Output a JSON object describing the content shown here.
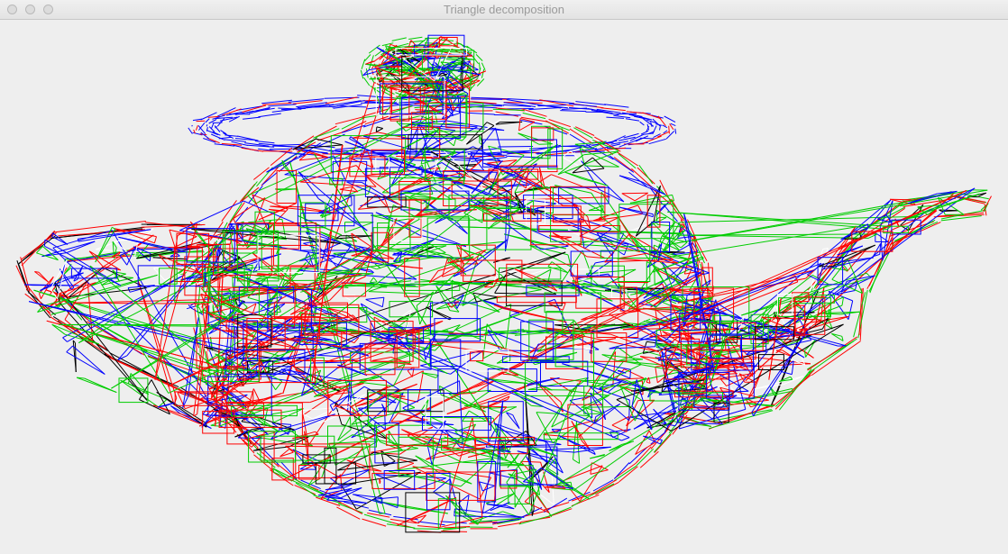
{
  "window": {
    "title": "Triangle decomposition"
  },
  "titlebar_buttons": [
    {
      "name": "close-button"
    },
    {
      "name": "minimize-button"
    },
    {
      "name": "zoom-button"
    }
  ],
  "canvas": {
    "background": "#eeeeee",
    "palette": [
      "#ff0000",
      "#00cc00",
      "#0000ff",
      "#000000",
      "#ffffff"
    ]
  }
}
